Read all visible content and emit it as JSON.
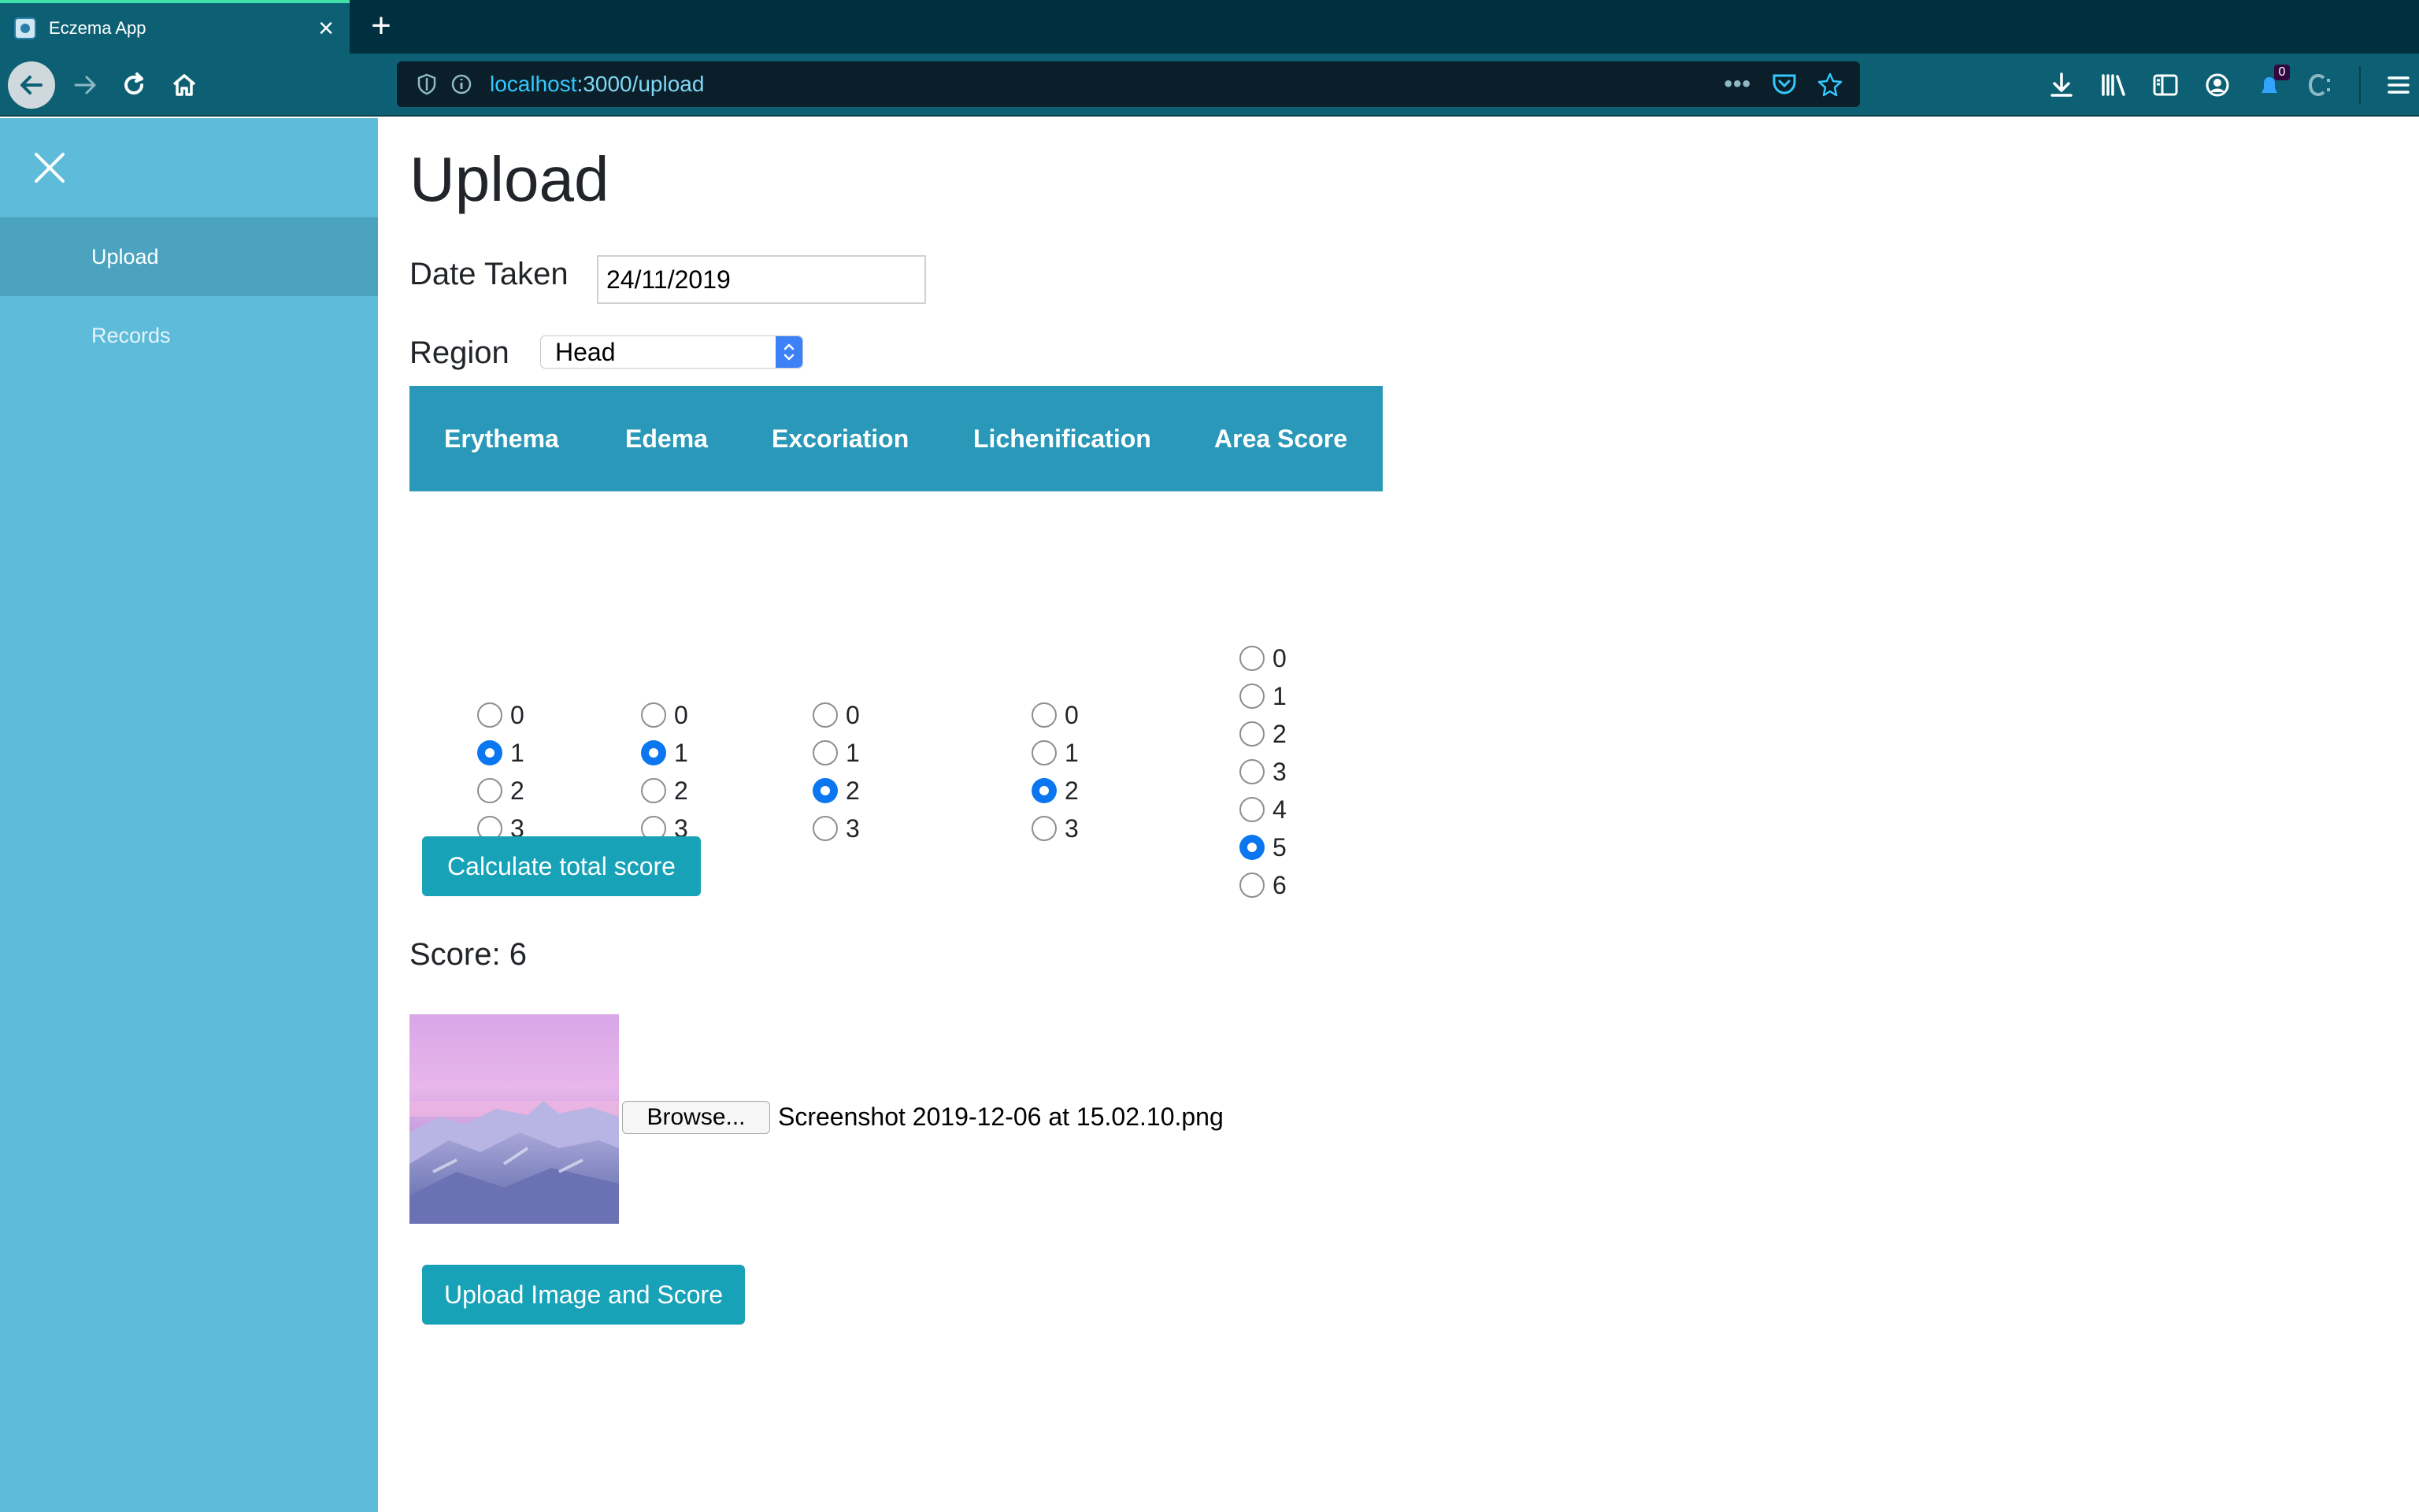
{
  "browser": {
    "tab_title": "Eczema App",
    "url_host": "localhost",
    "url_path": ":3000/upload",
    "notification_count": "0"
  },
  "sidebar": {
    "items": [
      {
        "label": "Upload",
        "active": true
      },
      {
        "label": "Records",
        "active": false
      }
    ]
  },
  "page": {
    "title": "Upload",
    "date_label": "Date Taken",
    "date_value": "24/11/2019",
    "region_label": "Region",
    "region_value": "Head"
  },
  "table": {
    "headers": [
      "Erythema",
      "Edema",
      "Excoriation",
      "Lichenification",
      "Area Score"
    ],
    "columns": [
      {
        "name": "Erythema",
        "options": [
          "0",
          "1",
          "2",
          "3"
        ],
        "selected": "1"
      },
      {
        "name": "Edema",
        "options": [
          "0",
          "1",
          "2",
          "3"
        ],
        "selected": "1"
      },
      {
        "name": "Excoriation",
        "options": [
          "0",
          "1",
          "2",
          "3"
        ],
        "selected": "2"
      },
      {
        "name": "Lichenification",
        "options": [
          "0",
          "1",
          "2",
          "3"
        ],
        "selected": "2"
      },
      {
        "name": "Area Score",
        "options": [
          "0",
          "1",
          "2",
          "3",
          "4",
          "5",
          "6"
        ],
        "selected": "5"
      }
    ]
  },
  "actions": {
    "calculate_label": "Calculate total score",
    "score_text": "Score: 6",
    "browse_label": "Browse...",
    "file_name": "Screenshot 2019-12-06 at 15.02.10.png",
    "upload_label": "Upload Image and Score"
  },
  "colors": {
    "sidebar": "#5ebcda",
    "sidebar_active": "#4ba3c0",
    "table_header": "#2a98b8",
    "button": "#17a2b8",
    "radio_checked": "#0a76f0"
  }
}
